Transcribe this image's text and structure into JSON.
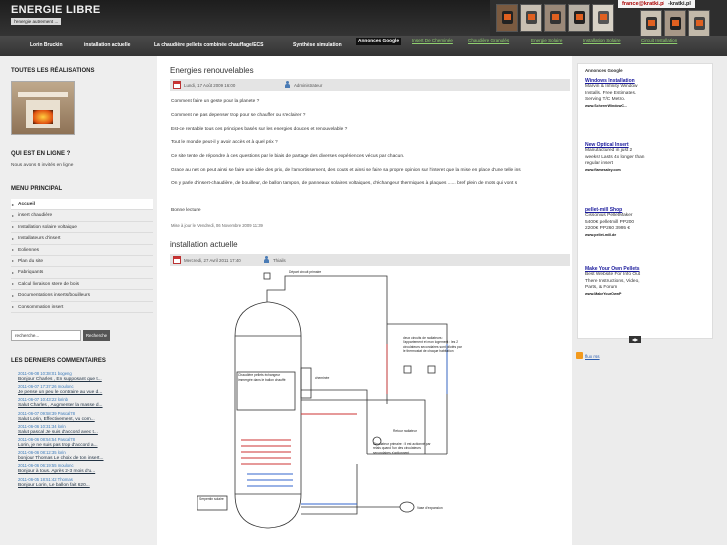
{
  "header": {
    "title": "ENERGIE LIBRE",
    "subtitle": "l'energie autrement ...",
    "banner_email": "france@kratki.pl",
    "banner_logo": "-kratki.pl"
  },
  "nav": {
    "items": [
      "Lorin Bruckin",
      "installation actuelle",
      "La chaudière pellets combinée chauffage/ECS",
      "Synthèse simulation"
    ]
  },
  "ads_bar": {
    "label": "Annonces Google",
    "links": [
      "Insert De Cheminée",
      "Chaudière Granulés",
      "Energie Solaire",
      "Installation Solaire",
      "Circuit Installation"
    ]
  },
  "sidebar": {
    "realisations_title": "TOUTES LES RÉALISATIONS",
    "online_title": "QUI EST EN LIGNE ?",
    "online_text": "Nous avons 6 invités en ligne",
    "menu_title": "MENU PRINCIPAL",
    "menu": [
      "Accueil",
      "insert chaudière",
      "Installation solaire voltaique",
      "Installateurs d'insert",
      "Eoliennes",
      "Plan du site",
      "Fabriquants",
      "Calcul livraison stere de bois",
      "Documentations inserts/bouilleurs",
      "Consommation insert"
    ],
    "search_value": "recherche...",
    "search_button": "Recherche",
    "comments_title": "LES DERNIERS COMMENTAIRES",
    "comments": [
      {
        "meta": "2011-06-08 10:38:01 bogeng",
        "text": "Bonjour Charles , En supposant que t..."
      },
      {
        "meta": "2011-06-07 17:37:26 moulonc",
        "text": "Je pense un peu le contraire au vue d..."
      },
      {
        "meta": "2011-06-07 10:43:22 lorinb",
        "text": "Salut Charles , Augmenter la masse d..."
      },
      {
        "meta": "2011-06-07 09:58:39 Pascal78",
        "text": "Salut Lorin, Effectivement, vu com..."
      },
      {
        "meta": "2011-06-06 10:31:34 lorin",
        "text": "Salut pascal Je suis d'accord avec t..."
      },
      {
        "meta": "2011-06-06 08:54:54 Pascal78",
        "text": "Lorin, je ne suis pas trop d'accord a..."
      },
      {
        "meta": "2011-06-06 08:12:35 lorin",
        "text": "bonjour Thomas Le choix de ton insert..."
      },
      {
        "meta": "2011-06-06 06:19:55 moulonc",
        "text": "Bonjour à tous. Après 2-3 mois d'u..."
      },
      {
        "meta": "2011-06-05 18:51:42 Thomas",
        "text": "Bonjour Lorin, Le ballon fait 620..."
      }
    ]
  },
  "posts": [
    {
      "title": "Energies renouvelables",
      "date": "Lundi, 17 Août 2009 16:00",
      "author": "Administrateur",
      "paragraphs": [
        "Comment faire un geste pour la planete ?",
        "Comment ne pas depenser trop pour se chauffer ou s'eclairer ?",
        "Est-ce rentable tous ces principes basés sur les energies douces et renouvelable ?",
        "Tout le monde peut-il y avoir accès et à quel prix ?",
        "Ce site tente de répondre à ces questions par le biais de partage des diverses expériences vécus par chacun.",
        "Grace au net on peut ainsi se faire une idée des prix, de l'amortissement, des couts et ainsi se faire sa propre opinion sur l'interet que la mise en place d'une telle ins",
        "On y parle d'insert-chaudière, de bouilleur, de ballon tampon, de panneaux solaires voltaiques, d'échangeur thermiques à plaques ...... bref plein de mots qui vont s"
      ],
      "footer": "Bonne lecture",
      "updated": "Mise à jour le Vendredi, 06 Novembre 2009 11:39"
    },
    {
      "title": "installation actuelle",
      "date": "Mercredi, 27 Avril 2011 17:40",
      "author": "Thiails"
    }
  ],
  "diagram": {
    "labels": {
      "depart": "Départ circuit primaire",
      "chaudiere": "Chaudière pellets échangeur immergée dans le ballon chauffé",
      "cheminee": "cheminée",
      "serpentin": "Serpentin solaire",
      "circuits": "deux circuits de radiateurs : l'appartement et mon logement : les 2 circulateurs secondaires sont pilotés par le thermostat de chaque habitation",
      "retour": "Retour radiateur",
      "circulateur": "Circulateur primaire : Il est actionné par relais quand l'un des circulateurs secondaires s'actionnent",
      "vase": "Vase d'expansion"
    }
  },
  "right": {
    "ads_label": "Annonces Google",
    "ads": [
      {
        "title": "Windows Installation",
        "desc": "Marvin & Infinity Window Installs. Free Estimates. Serving T/C Metro.",
        "url": "www.SchererWindowC..."
      },
      {
        "title": "New Optical Insert",
        "desc": "Manufactured in just 2 weeks! Lasts 4x longer than regular insert",
        "url": "www.flamesaley.com"
      },
      {
        "title": "pellet-mill Shop",
        "desc": "Cissonius PelletMaker 5400€ pelletmill PP200 2200€ PP260 3995 €",
        "url": "www.pellet-mill.de"
      },
      {
        "title": "Make Your Own Pellets",
        "desc": "Best Website For Info Out There Instructions, Video, Parts, & Forum",
        "url": "www.MakeYourOwnP"
      }
    ],
    "rss_label": "flux rss"
  },
  "colors": {
    "header_bg": "#2a2a2a",
    "nav_bg": "#3d3d3d",
    "sidebar_bg": "#eeeeee",
    "ad_link": "#1a1a9c",
    "green_link": "#8fcf6f"
  }
}
